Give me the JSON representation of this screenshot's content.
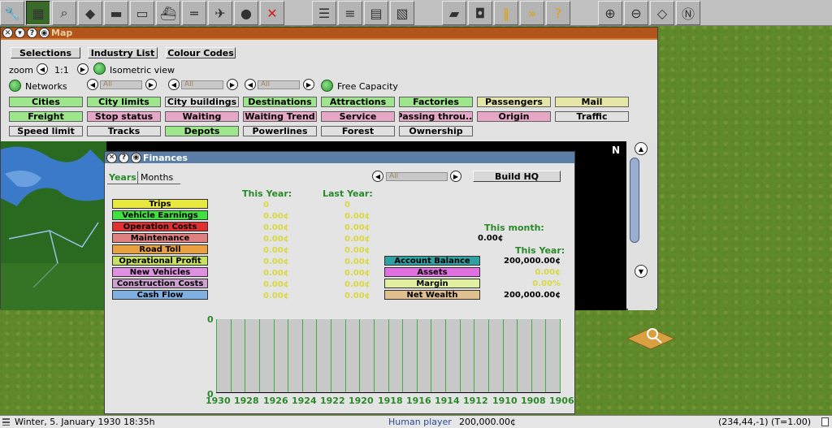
{
  "toolbar": {
    "icons": [
      "wrench-icon",
      "map-icon",
      "magnifier-icon",
      "terrain-icon",
      "road-vehicle-icon",
      "tram-icon",
      "ship-icon",
      "monorail-icon",
      "airplane-icon",
      "road-icon",
      "cross-icon",
      "line-management-icon",
      "list-icon",
      "finance-icon",
      "graph-icon",
      "train-icon",
      "camera-icon",
      "pause-icon",
      "fast-forward-icon",
      "help-icon",
      "zoom-in-icon",
      "zoom-out-icon",
      "grid-icon",
      "compass-icon"
    ]
  },
  "map_window": {
    "title": "Map",
    "tabs": [
      "Selections",
      "Industry List",
      "Colour Codes"
    ],
    "zoom_label": "zoom",
    "zoom_value": "1:1",
    "isometric_label": "Isometric view",
    "networks_label": "Networks",
    "filter_all": "All",
    "free_capacity_label": "Free Capacity",
    "filters": [
      {
        "label": "Cities",
        "color": "#9ee68c"
      },
      {
        "label": "City limits",
        "color": "#9ee68c"
      },
      {
        "label": "City buildings",
        "color": "#e0e0e0"
      },
      {
        "label": "Destinations",
        "color": "#9ee68c"
      },
      {
        "label": "Attractions",
        "color": "#9ee68c"
      },
      {
        "label": "Factories",
        "color": "#9ee68c"
      },
      {
        "label": "Passengers",
        "color": "#e6e6a6"
      },
      {
        "label": "Mail",
        "color": "#e6e6a6"
      },
      {
        "label": "Freight",
        "color": "#9ee68c"
      },
      {
        "label": "Stop status",
        "color": "#e6a6c6"
      },
      {
        "label": "Waiting",
        "color": "#e6a6c6"
      },
      {
        "label": "Waiting Trend",
        "color": "#e6a6c6"
      },
      {
        "label": "Service",
        "color": "#e6a6c6"
      },
      {
        "label": "Passing throu...",
        "color": "#e6a6c6"
      },
      {
        "label": "Origin",
        "color": "#e6a6c6"
      },
      {
        "label": "Traffic",
        "color": "#e0e0e0"
      },
      {
        "label": "Speed limit",
        "color": "#e0e0e0"
      },
      {
        "label": "Tracks",
        "color": "#e0e0e0"
      },
      {
        "label": "Depots",
        "color": "#9ee68c"
      },
      {
        "label": "Powerlines",
        "color": "#e0e0e0"
      },
      {
        "label": "Forest",
        "color": "#e0e0e0"
      },
      {
        "label": "Ownership",
        "color": "#e0e0e0"
      }
    ],
    "compass": "N"
  },
  "finances": {
    "title": "Finances",
    "tabs": [
      "Years",
      "Months"
    ],
    "filter_all": "All",
    "build_hq": "Build HQ",
    "col_this_year": "This Year:",
    "col_last_year": "Last Year:",
    "rows": [
      {
        "label": "Trips",
        "color": "#e8e840",
        "this": "0",
        "last": "0"
      },
      {
        "label": "Vehicle Earnings",
        "color": "#40e040",
        "this": "0.00¢",
        "last": "0.00¢"
      },
      {
        "label": "Operation Costs",
        "color": "#e03030",
        "this": "0.00¢",
        "last": "0.00¢"
      },
      {
        "label": "Maintenance",
        "color": "#e08080",
        "this": "0.00¢",
        "last": "0.00¢"
      },
      {
        "label": "Road Toll",
        "color": "#e8a040",
        "this": "0.00¢",
        "last": "0.00¢"
      },
      {
        "label": "Operational Profit",
        "color": "#c8e060",
        "this": "0.00¢",
        "last": "0.00¢"
      },
      {
        "label": "New Vehicles",
        "color": "#e090e0",
        "this": "0.00¢",
        "last": "0.00¢"
      },
      {
        "label": "Construction Costs",
        "color": "#d0a0d0",
        "this": "0.00¢",
        "last": "0.00¢"
      },
      {
        "label": "Cash Flow",
        "color": "#80b0e0",
        "this": "0.00¢",
        "last": "0.00¢"
      }
    ],
    "this_month_label": "This month:",
    "this_month_value": "0.00¢",
    "this_year_label": "This Year:",
    "summary": [
      {
        "label": "Account Balance",
        "color": "#30a0a0",
        "value": "200,000.00¢",
        "vcolor": "#000"
      },
      {
        "label": "Assets",
        "color": "#e070e0",
        "value": "0.00¢",
        "vcolor": "#d8d840"
      },
      {
        "label": "Margin",
        "color": "#e0f0a0",
        "value": "0.00%",
        "vcolor": "#d8d840"
      },
      {
        "label": "Net Wealth",
        "color": "#e0c090",
        "value": "200,000.00¢",
        "vcolor": "#000"
      }
    ],
    "chart_ymax": "0",
    "chart_ymin": "0"
  },
  "chart_data": {
    "type": "line",
    "x": [
      1930,
      1929,
      1928,
      1927,
      1926,
      1925,
      1924,
      1923,
      1922,
      1921,
      1920,
      1919,
      1918,
      1917,
      1916,
      1915,
      1914,
      1913,
      1912,
      1911,
      1910,
      1909,
      1908,
      1907,
      1906
    ],
    "x_tick_labels": [
      "1930",
      "1928",
      "1926",
      "1924",
      "1922",
      "1920",
      "1918",
      "1916",
      "1914",
      "1912",
      "1910",
      "1908",
      "1906"
    ],
    "y_tick_labels": [
      "0",
      "0"
    ],
    "series": [
      {
        "values": [
          0,
          0,
          0,
          0,
          0,
          0,
          0,
          0,
          0,
          0,
          0,
          0,
          0,
          0,
          0,
          0,
          0,
          0,
          0,
          0,
          0,
          0,
          0,
          0,
          0
        ]
      }
    ],
    "ylim": [
      0,
      0
    ],
    "grid": true
  },
  "status": {
    "date": "Winter, 5. January 1930 18:35h",
    "player": "Human player",
    "money": "200,000.00¢",
    "coords": "(234,44,-1) (T=1.00)"
  }
}
